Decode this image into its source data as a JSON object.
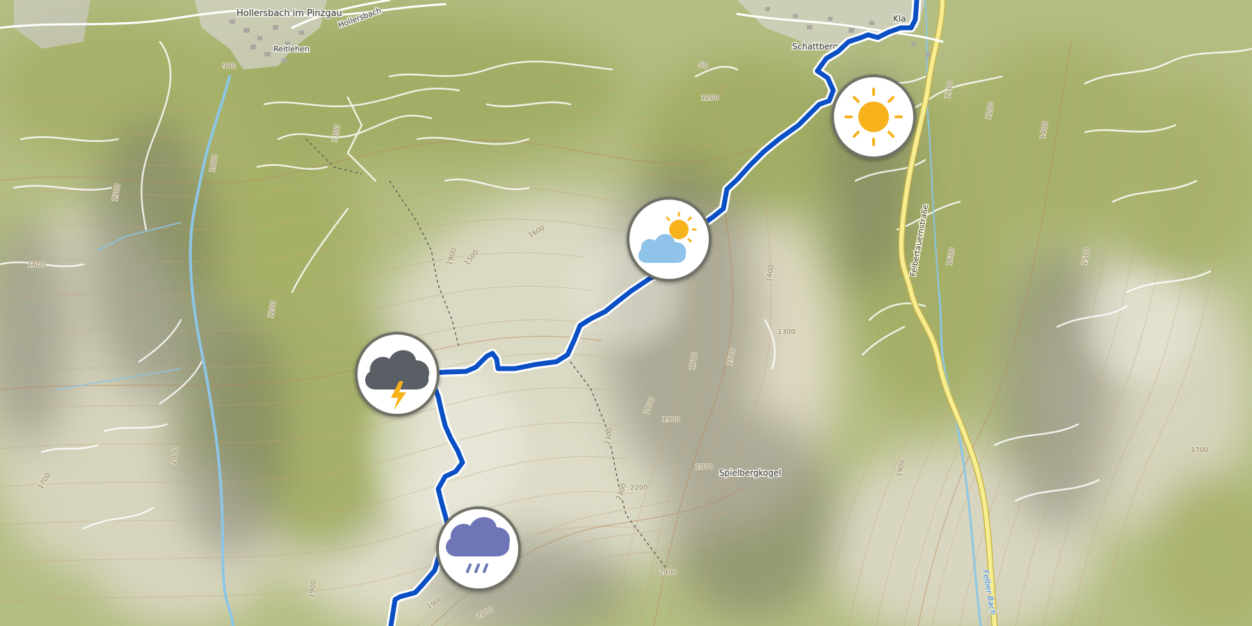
{
  "map": {
    "places": [
      {
        "id": "hollersbach-im-pinzgau",
        "name": "Hollersbach im Pinzgau"
      },
      {
        "id": "hollersbach-road",
        "name": "Hollersbach"
      },
      {
        "id": "reitlehen",
        "name": "Reitlehen"
      },
      {
        "id": "schattberg",
        "name": "Schattberg"
      },
      {
        "id": "klausen",
        "name": "Kla"
      },
      {
        "id": "spielbergkogel",
        "name": "Spielbergkogel"
      },
      {
        "id": "felbertauernstrasse",
        "name": "Felbertauernstraße"
      },
      {
        "id": "felber-bach",
        "name": "Felber Bach"
      }
    ],
    "contour_labels": [
      "900",
      "1000",
      "1100",
      "1200",
      "1300",
      "1400",
      "1500",
      "1600",
      "1700",
      "1800",
      "1900",
      "2000",
      "2100",
      "2200",
      "2300",
      "2400",
      "50"
    ],
    "weather_markers": [
      {
        "id": "sunny",
        "icon": "sun-icon",
        "condition": "sunny"
      },
      {
        "id": "partly-cloudy",
        "icon": "partly-cloudy-icon",
        "condition": "partly cloudy"
      },
      {
        "id": "thunderstorm",
        "icon": "thunderstorm-icon",
        "condition": "thunderstorm"
      },
      {
        "id": "rain",
        "icon": "rain-icon",
        "condition": "rain"
      }
    ],
    "colors": {
      "route": "#0a4fc4",
      "route_casing": "#ffffff",
      "terrain_green": "#a8b46a",
      "terrain_light": "#dcdcc4",
      "road_main": "#f4ec8a",
      "water": "#8cc6e6",
      "sun": "#f7b21b",
      "cloud_light": "#8fc3ea",
      "cloud_dark": "#5a5f66",
      "cloud_rain": "#6e76b8",
      "lightning": "#f7b21b",
      "marker_ring": "#6f6f66"
    }
  }
}
